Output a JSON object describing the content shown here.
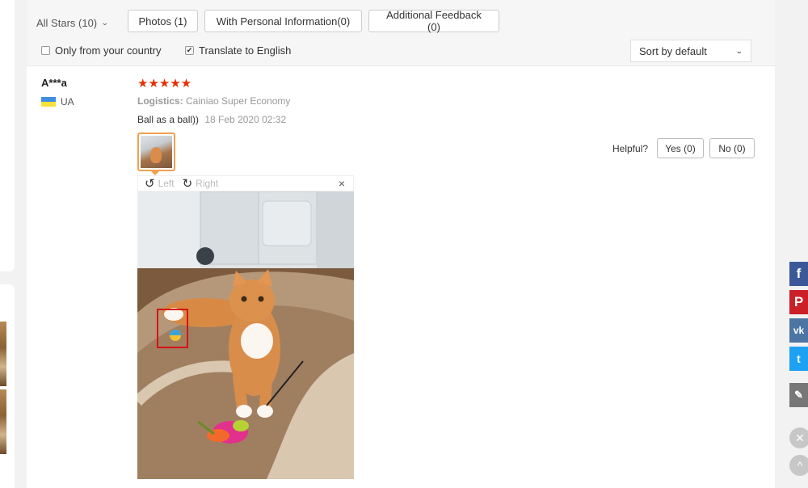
{
  "filters": {
    "all_stars_label": "All Stars (10)",
    "photos_label": "Photos (1)",
    "personal_info_label": "With Personal Information(0)",
    "feedback_label": "Additional Feedback (0)",
    "only_country_label": "Only from your country",
    "only_country_checked": false,
    "translate_label": "Translate to English",
    "translate_checked": true,
    "sort_label": "Sort by default"
  },
  "review": {
    "reviewer": "A***a",
    "country_code": "UA",
    "rating": 5,
    "stars": "★★★★★",
    "logistics_label": "Logistics:",
    "logistics_value": "Cainiao Super Economy",
    "text": "Ball as a ball))",
    "date": "18 Feb 2020 02:32",
    "helpful_label": "Helpful?",
    "yes_label": "Yes (0)",
    "no_label": "No (0)"
  },
  "viewer": {
    "rotate_left_label": "Left",
    "rotate_right_label": "Right",
    "close_glyph": "×"
  },
  "share": {
    "facebook": "f",
    "pinterest": "P",
    "vk": "vk",
    "twitter": "t",
    "edit": "✎",
    "close": "✕",
    "up": "^"
  },
  "colors": {
    "star": "#e62e04",
    "thumb_border": "#f0a050",
    "facebook": "#3b5998",
    "pinterest": "#cb2027",
    "vk": "#4c75a3",
    "twitter": "#1da1f2"
  }
}
